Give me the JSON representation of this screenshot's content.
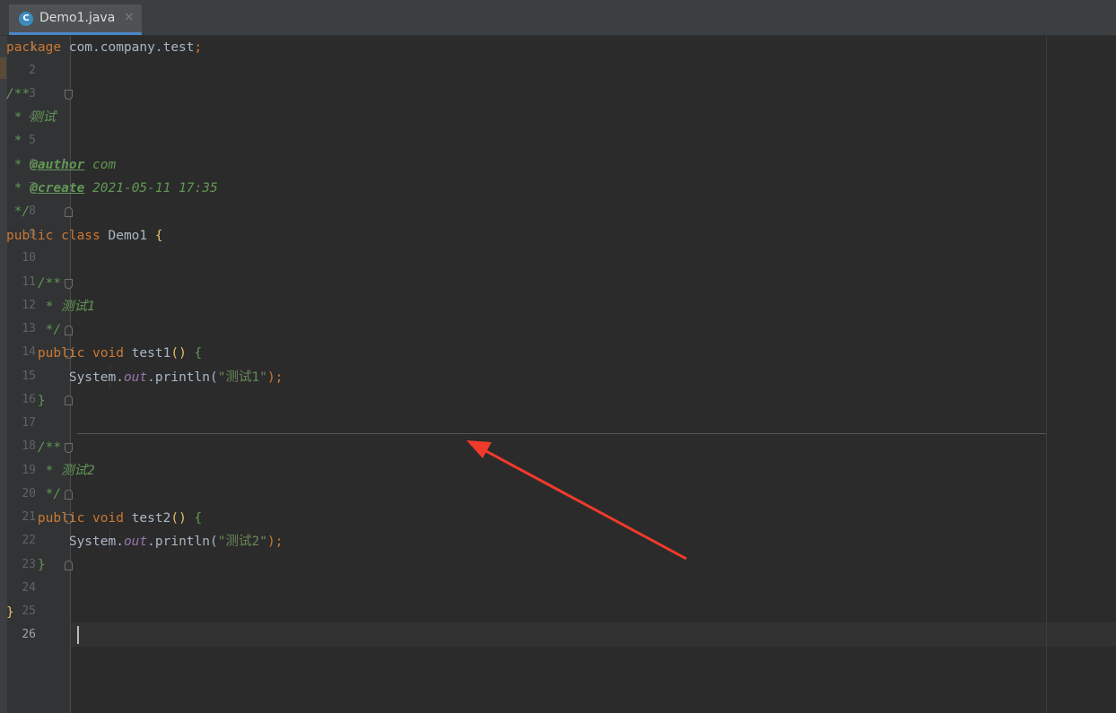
{
  "tab": {
    "icon_letter": "C",
    "label": "Demo1.java",
    "close": "×"
  },
  "icons": {
    "tab_icon": "java-class-icon",
    "fold": "fold-marker-icon",
    "annotation": "red-arrow"
  },
  "colors": {
    "accent": "#4a88c7",
    "keyword": "#cc7832",
    "comment": "#629755",
    "string": "#6a8759",
    "field": "#9876aa",
    "arrow": "#f03a2b"
  },
  "line_numbers": [
    "1",
    "2",
    "3",
    "4",
    "5",
    "6",
    "7",
    "8",
    "9",
    "10",
    "11",
    "12",
    "13",
    "14",
    "15",
    "16",
    "17",
    "18",
    "19",
    "20",
    "21",
    "22",
    "23",
    "24",
    "25",
    "26"
  ],
  "code": {
    "l1_kw": "package",
    "l1_rest": " com.company.test",
    "l1_semi": ";",
    "l3": "/**",
    "l4": " * 测试",
    "l5": " *",
    "l6_pre": " * ",
    "l6_tag": "@author",
    "l6_rest": " com",
    "l7_pre": " * ",
    "l7_tag": "@create",
    "l7_rest": " 2021-05-11 17:35",
    "l8": " */",
    "l9_kw": "public class",
    "l9_name": " Demo1 ",
    "l9_brace": "{",
    "l11": "    /**",
    "l12": "     * 测试1",
    "l13": "     */",
    "l14_kw": "    public void",
    "l14_name": " test1",
    "l14_paren": "()",
    "l14_brace": " {",
    "l15_a": "        System.",
    "l15_field": "out",
    "l15_b": ".println(",
    "l15_str": "\"测试1\"",
    "l15_c": ");",
    "l16": "    }",
    "l18": "    /**",
    "l19": "     * 测试2",
    "l20": "     */",
    "l21_kw": "    public void",
    "l21_name": " test2",
    "l21_paren": "()",
    "l21_brace": " {",
    "l22_a": "        System.",
    "l22_field": "out",
    "l22_b": ".println(",
    "l22_str": "\"测试2\"",
    "l22_c": ");",
    "l23": "    }",
    "l25": "}"
  }
}
